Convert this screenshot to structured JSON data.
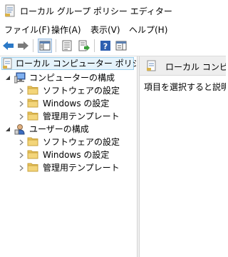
{
  "window": {
    "title": "ローカル グループ ポリシー エディター"
  },
  "menubar": {
    "items": [
      {
        "label": "ファイル(F)"
      },
      {
        "label": "操作(A)"
      },
      {
        "label": "表示(V)"
      },
      {
        "label": "ヘルプ(H)"
      }
    ]
  },
  "toolbar": {
    "buttons": [
      {
        "icon": "back-arrow-icon"
      },
      {
        "icon": "forward-arrow-icon"
      },
      {
        "icon": "show-hide-tree-icon"
      },
      {
        "icon": "properties-icon"
      },
      {
        "icon": "export-list-icon"
      },
      {
        "icon": "help-icon"
      },
      {
        "icon": "show-hide-action-pane-icon"
      }
    ]
  },
  "tree": {
    "root": {
      "label": "ローカル コンピューター ポリシー"
    },
    "computer_config": {
      "label": "コンピューターの構成",
      "children": [
        {
          "label": "ソフトウェアの設定"
        },
        {
          "label": "Windows の設定"
        },
        {
          "label": "管理用テンプレート"
        }
      ]
    },
    "user_config": {
      "label": "ユーザーの構成",
      "children": [
        {
          "label": "ソフトウェアの設定"
        },
        {
          "label": "Windows の設定"
        },
        {
          "label": "管理用テンプレート"
        }
      ]
    }
  },
  "right_pane": {
    "header": "ローカル コンピューター ポリシー",
    "message": "項目を選択すると説明が表示されます。"
  },
  "colors": {
    "selection_bg": "#e5f3fb",
    "selection_border": "#9ccfec",
    "folder": "#e8c35a",
    "toolbar_arrow": "#2b79c7"
  }
}
